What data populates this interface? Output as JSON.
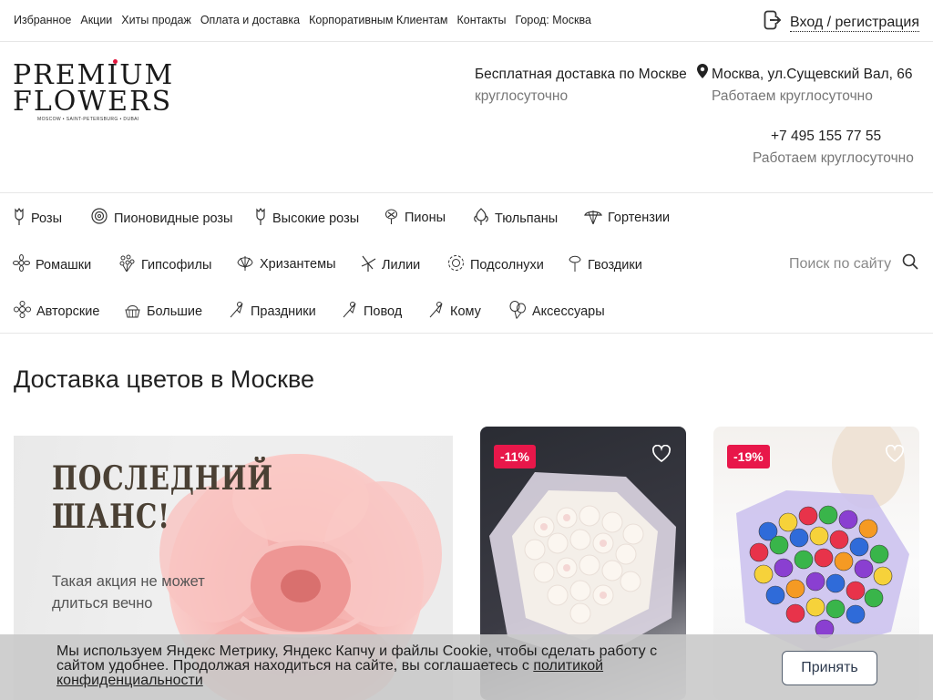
{
  "topnav": {
    "items": [
      "Избранное",
      "Акции",
      "Хиты продаж",
      "Оплата и доставка",
      "Корпоративным Клиентам",
      "Контакты",
      "Город: Москва"
    ],
    "login_label": "Вход / регистрация"
  },
  "header": {
    "logo_line1": "PREMIUM",
    "logo_line2": "FLOWERS",
    "logo_sub": "MOSCOW • SAINT-PETERSBURG • DUBAI",
    "delivery_label": "Бесплатная доставка по Москве",
    "delivery_hours": "круглосуточно",
    "address": "Москва, ул.Сущевский Вал, 66",
    "address_hours": "Работаем круглосуточно",
    "phone": "+7 495 155 77 55",
    "phone_hours": "Работаем круглосуточно"
  },
  "categories": {
    "row1": [
      "Розы",
      "Пионовидные розы",
      "Высокие розы",
      "Пионы",
      "Тюльпаны",
      "Гортензии"
    ],
    "row2": [
      "Ромашки",
      "Гипсофилы",
      "Хризантемы",
      "Лилии",
      "Подсолнухи",
      "Гвоздики"
    ],
    "row3": [
      "Авторские",
      "Большие",
      "Праздники",
      "Повод",
      "Кому",
      "Аксессуары"
    ],
    "search_placeholder": "Поиск по сайту"
  },
  "main": {
    "title": "Доставка цветов в Москве",
    "promo_title_line1": "ПОСЛЕДНИЙ",
    "promo_title_line2": "ШАНС!",
    "promo_sub_line1": "Такая акция не может",
    "promo_sub_line2": "длиться вечно",
    "products": [
      {
        "discount": "-11%"
      },
      {
        "discount": "-19%"
      }
    ]
  },
  "cookie": {
    "text": "Мы используем Яндекс Метрику, Яндекс Капчу и файлы Cookie, чтобы сделать работу с сайтом удобнее. Продолжая находиться на сайте, вы соглашаетесь с ",
    "link": "политикой конфиденциальности",
    "accept_label": "Принять"
  },
  "colors": {
    "accent": "#e8174a",
    "logo_dot": "#e3173e",
    "text_muted": "#777777"
  }
}
